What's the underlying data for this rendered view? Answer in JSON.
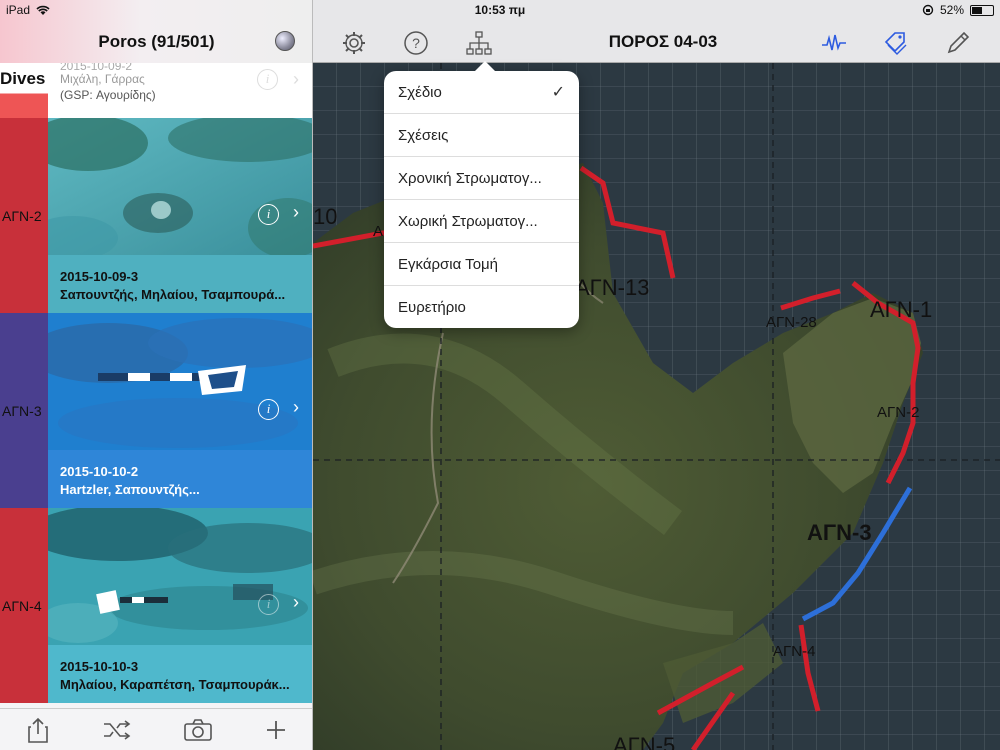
{
  "status": {
    "device": "iPad",
    "time": "10:53 πμ",
    "battery": "52%",
    "battery_level": 0.52
  },
  "left_panel": {
    "title": "Poros (91/501)",
    "section_label": "Dives",
    "top_partial": {
      "date": "2015-10-09-2",
      "people": "Μιχάλη, Γάρρας",
      "gsp": "(GSP: Αγουρίδης)"
    },
    "dives": [
      {
        "code": "ΑΓΝ-2",
        "date": "2015-10-09-3",
        "people": "Σαπουντζής, Μηλαίου, Τσαμπουρά...",
        "side_color": "#c8303a",
        "caption_bg": "#4fb0c0",
        "photo": "sandy-seabed"
      },
      {
        "code": "ΑΓΝ-3",
        "date": "2015-10-10-2",
        "people": "Hartzler, Σαπουντζής...",
        "side_color": "#4a3f8f",
        "caption_bg": "#2f86d8",
        "photo": "scale-bar-seabed"
      },
      {
        "code": "ΑΓΝ-4",
        "date": "2015-10-10-3",
        "people": "Μηλαίου, Καραπέτση, Τσαμπουράκ...",
        "side_color": "#c8303a",
        "caption_bg": "#4fb8cc",
        "photo": "rubble-seabed"
      }
    ],
    "toolbar": [
      "share-icon",
      "shuffle-icon",
      "camera-icon",
      "add-icon"
    ]
  },
  "map": {
    "title": "ΠΟΡΟΣ 04-03",
    "toolbar_left": [
      "settings-icon",
      "help-icon",
      "hierarchy-icon"
    ],
    "toolbar_right": [
      "waveform-icon",
      "tags-icon",
      "edit-icon"
    ],
    "accent": "#2d5be0",
    "labels": {
      "agn1": "ΑΓΝ-1",
      "agn2": "ΑΓΝ-2",
      "agn3": "ΑΓΝ-3",
      "agn4": "ΑΓΝ-4",
      "agn5": "ΑΓΝ-5",
      "agn13": "ΑΓΝ-13",
      "agn28": "ΑΓΝ-28",
      "n10": "10",
      "a_partial": "Α"
    },
    "line_colors": {
      "red": "#d21f2b",
      "blue": "#2d6fd8"
    }
  },
  "popover": {
    "items": [
      {
        "label": "Σχέδιο",
        "checked": true
      },
      {
        "label": "Σχέσεις",
        "checked": false
      },
      {
        "label": "Χρονική Στρωματογ...",
        "checked": false
      },
      {
        "label": "Χωρική Στρωματογ...",
        "checked": false
      },
      {
        "label": "Εγκάρσια Τομή",
        "checked": false
      },
      {
        "label": "Ευρετήριο",
        "checked": false
      }
    ],
    "check_glyph": "✓"
  }
}
